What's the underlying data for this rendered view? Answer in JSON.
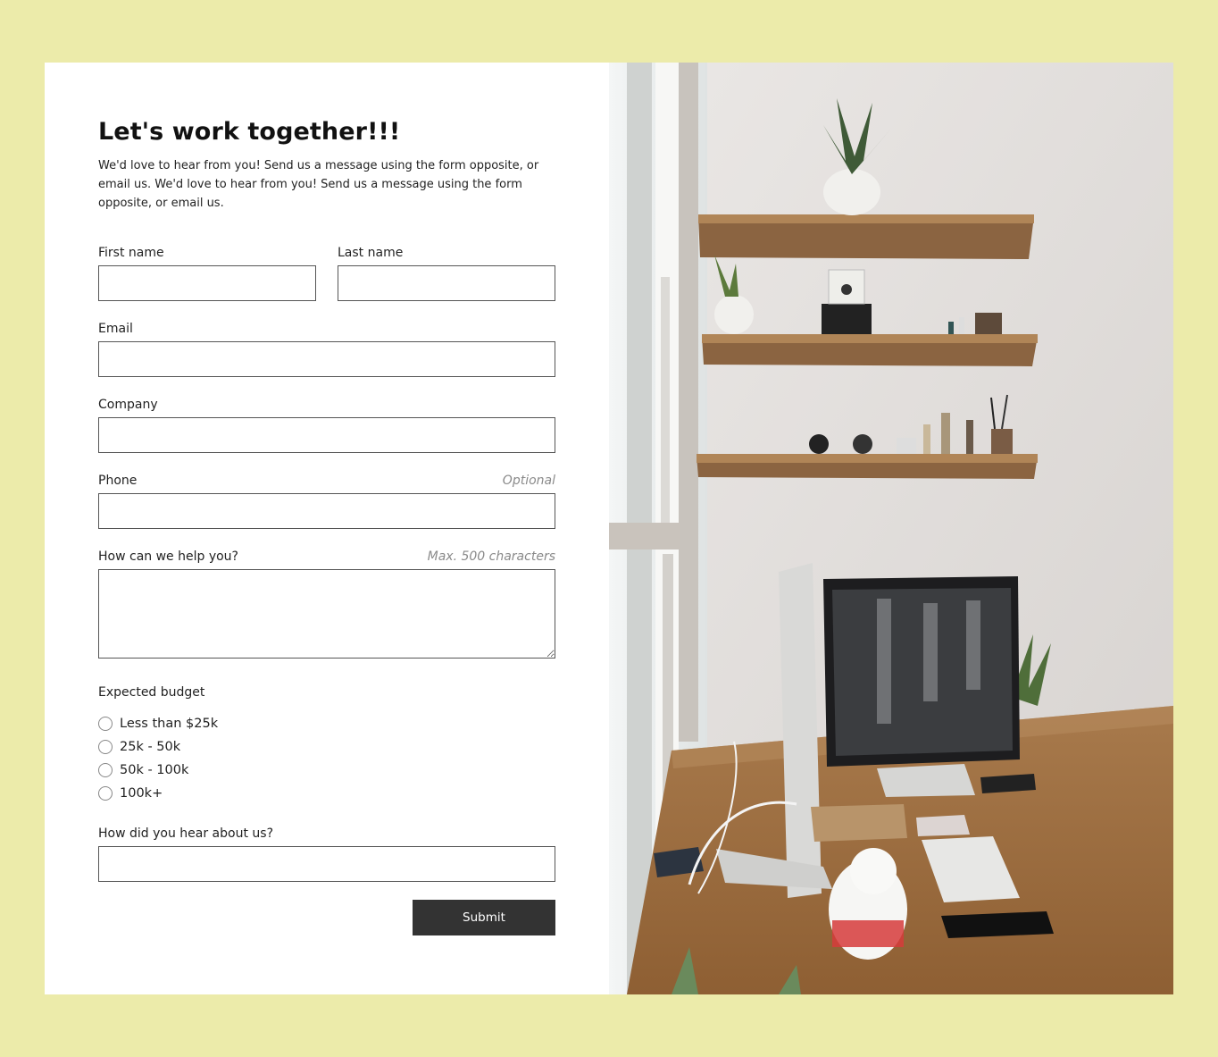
{
  "form": {
    "title": "Let's work together!!!",
    "intro": "We'd love to hear from you! Send us a message using the form opposite, or email us. We'd love to hear from you! Send us a message using the form opposite, or email us.",
    "first_name_label": "First name",
    "last_name_label": "Last name",
    "email_label": "Email",
    "company_label": "Company",
    "phone_label": "Phone",
    "phone_hint": "Optional",
    "help_label": "How can we help you?",
    "help_hint": "Max. 500 characters",
    "budget_label": "Expected budget",
    "budget_options": [
      "Less than $25k",
      "25k - 50k",
      "50k - 100k",
      "100k+"
    ],
    "hear_label": "How did you hear about us?",
    "submit_label": "Submit"
  },
  "colors": {
    "page_background": "#ecebaa",
    "button": "#333333"
  }
}
